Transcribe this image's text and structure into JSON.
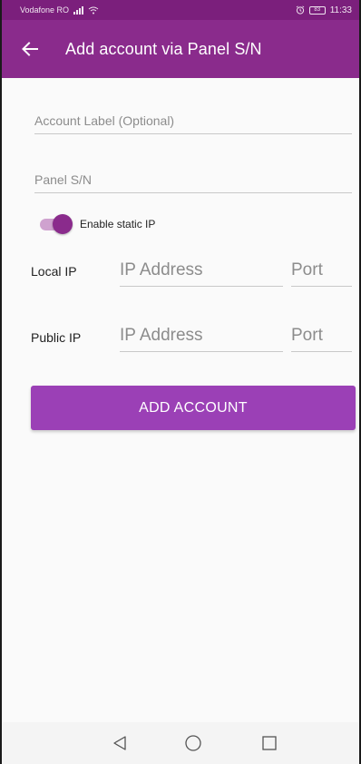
{
  "status_bar": {
    "carrier": "Vodafone RO",
    "battery": "83",
    "time": "11:33"
  },
  "app_bar": {
    "title": "Add account via Panel S/N"
  },
  "form": {
    "account_label_placeholder": "Account Label (Optional)",
    "panel_sn_placeholder": "Panel S/N",
    "static_ip_toggle_label": "Enable static IP",
    "static_ip_enabled": true,
    "local_ip": {
      "label": "Local IP",
      "address_placeholder": "IP Address",
      "port_placeholder": "Port"
    },
    "public_ip": {
      "label": "Public IP",
      "address_placeholder": "IP Address",
      "port_placeholder": "Port"
    },
    "add_button_label": "ADD ACCOUNT"
  },
  "colors": {
    "status_bar": "#7b1f7c",
    "app_bar": "#8a2b8c",
    "button": "#9b40b6",
    "toggle_thumb": "#8a2b8c",
    "toggle_track": "#cfa2cf"
  },
  "icons": {
    "back": "arrow-left-icon",
    "signal": "signal-icon",
    "wifi": "wifi-icon",
    "alarm": "alarm-icon",
    "battery": "battery-icon",
    "nav_back": "triangle-back-icon",
    "nav_home": "circle-home-icon",
    "nav_recents": "square-recents-icon"
  }
}
